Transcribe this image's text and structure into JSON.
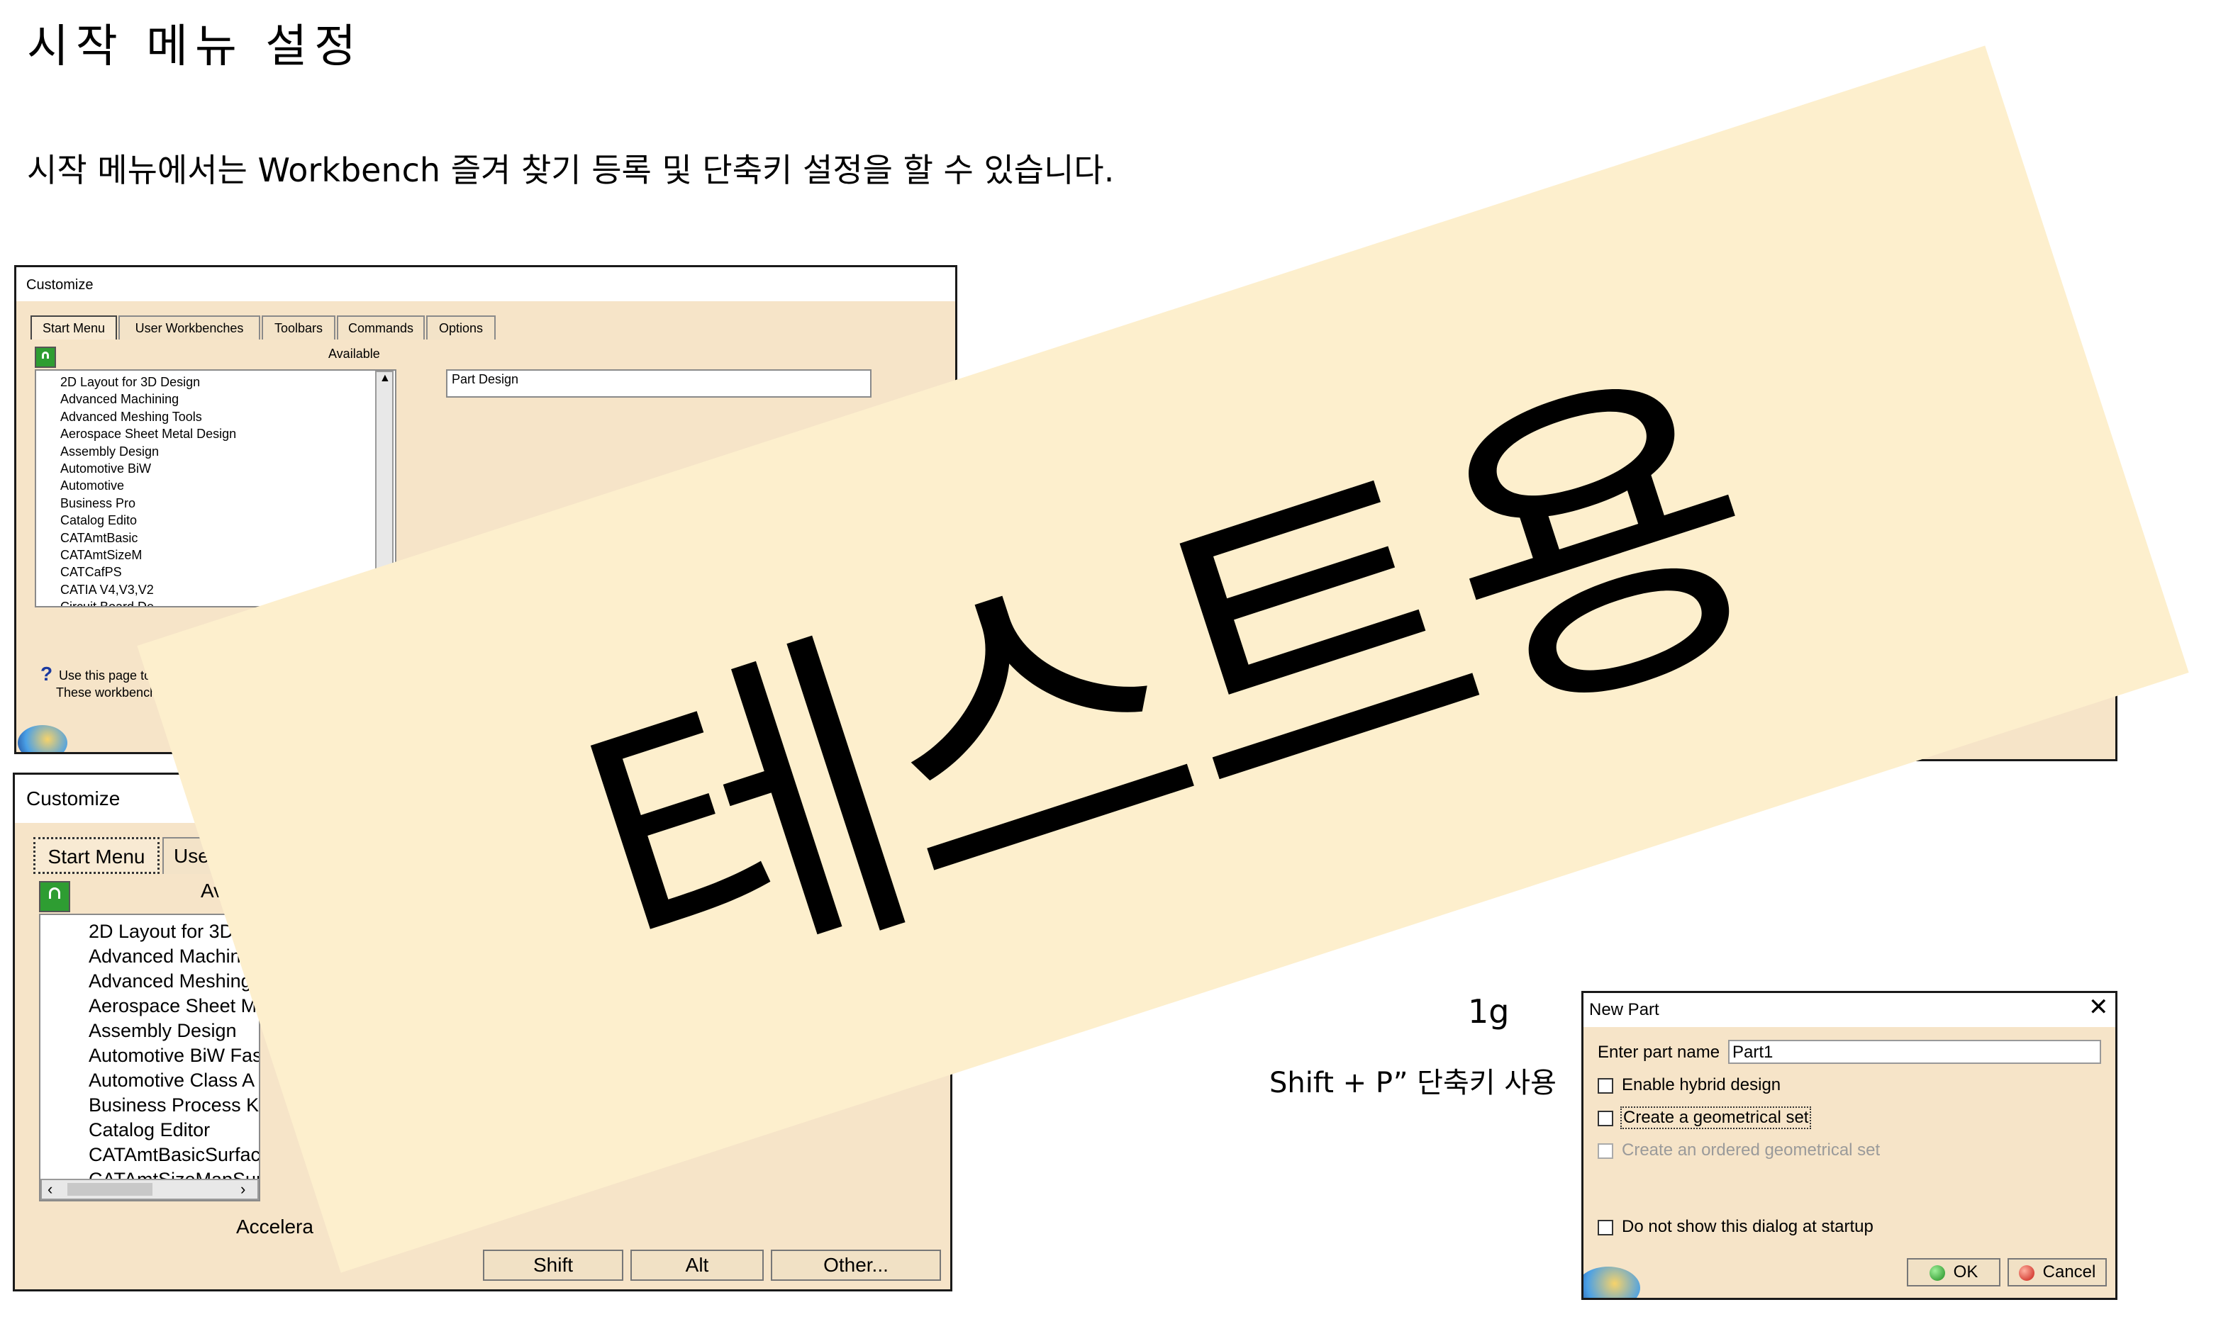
{
  "document": {
    "title": "시작 메뉴 설정",
    "intro": "시작 메뉴에서는 Workbench 즐겨 찾기 등록 및 단축키 설정을 할 수 있습니다.",
    "fragment_1": "1g",
    "fragment_2": "Shift + P” 단축키 사용"
  },
  "dialog_top": {
    "title": "Customize",
    "tabs": [
      "Start Menu",
      "User Workbenches",
      "Toolbars",
      "Commands",
      "Options"
    ],
    "available_label": "Available",
    "favorite_first": "Part Design",
    "items": [
      "2D Layout for 3D Design",
      "Advanced Machining",
      "Advanced Meshing Tools",
      "Aerospace Sheet Metal  Design",
      "Assembly Design",
      "Automotive BiW",
      "Automotive",
      "Business Pro",
      "Catalog Edito",
      "CATAmtBasic",
      "CATAmtSizeM",
      "CATCafPS",
      "CATIA V4,V3,V2",
      "Circuit Board De"
    ],
    "help_line_1": "Use this page to ma",
    "help_line_2": "These workbenches a"
  },
  "dialog_bottom": {
    "title": "Customize",
    "tabs": [
      "Start Menu",
      "User"
    ],
    "available_label": "Ava",
    "items": [
      "2D Layout for 3D L",
      "Advanced Machinin",
      "Advanced Meshing T",
      "Aerospace Sheet Me",
      "Assembly Design",
      "Automotive BiW Fas",
      "Automotive Class A",
      "Business Process Kno",
      "Catalog Editor",
      "CATAmtBasicSurface",
      "CATAmtSizeMapSur"
    ],
    "accelerator_label": "Accelera",
    "buttons": {
      "shift": "Shift",
      "alt": "Alt",
      "other": "Other..."
    }
  },
  "dialog_new_part": {
    "title": "New Part",
    "name_label": "Enter part name",
    "name_value": "Part1",
    "options": [
      {
        "label": "Enable hybrid design",
        "checked": false,
        "disabled": false
      },
      {
        "label": "Create a geometrical set",
        "checked": false,
        "disabled": false
      },
      {
        "label": "Create an ordered geometrical set",
        "checked": false,
        "disabled": true
      }
    ],
    "startup_option": "Do not show this dialog at startup",
    "ok_label": "OK",
    "cancel_label": "Cancel"
  },
  "watermark": {
    "text": "테스트용",
    "color": "#fdefcd"
  },
  "icons": {
    "close": "close-icon",
    "help": "help-icon",
    "lock": "lock-icon",
    "ok": "green-dot-icon",
    "cancel": "red-dot-icon"
  }
}
